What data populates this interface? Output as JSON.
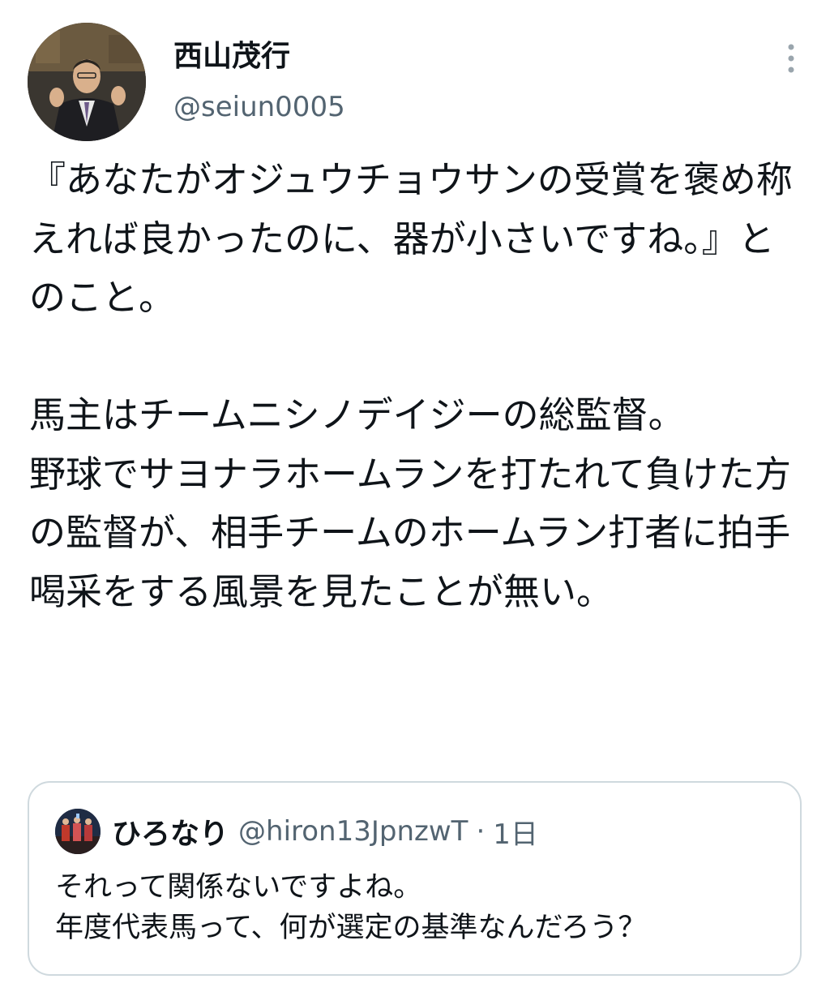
{
  "tweet": {
    "author": {
      "display_name": "西山茂行",
      "handle": "@seiun0005",
      "avatar_icon": "person-photo-avatar"
    },
    "more_icon": "more-vertical-icon",
    "text": "『あなたがオジュウチョウサンの受賞を褒め称えれば良かったのに、器が小さいですね。』とのこと。\n\n馬主はチームニシノデイジーの総監督。\n野球でサヨナラホームランを打たれて負けた方の監督が、相手チームのホームラン打者に拍手喝采をする風景を見たことが無い。"
  },
  "quoted_tweet": {
    "author": {
      "display_name": "ひろなり",
      "handle": "@hiron13JpnzwT",
      "avatar_icon": "group-photo-avatar"
    },
    "separator": "·",
    "timestamp": "1日",
    "text": "それって関係ないですよね。\n年度代表馬って、何が選定の基準なんだろう？"
  },
  "colors": {
    "text_primary": "#0f1419",
    "text_secondary": "#536471",
    "border": "#cfd9de",
    "background": "#ffffff"
  }
}
